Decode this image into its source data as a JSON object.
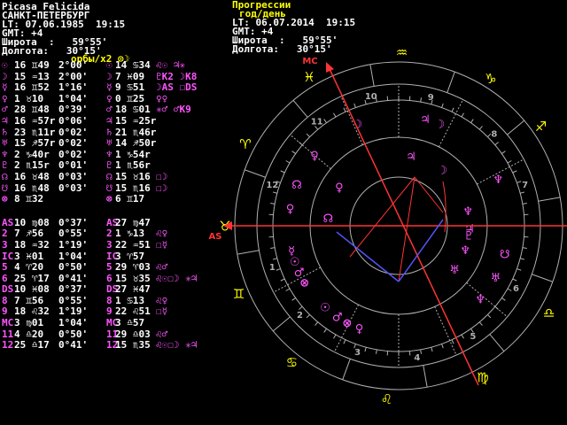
{
  "natal": {
    "name": "Picasa Felicida",
    "city": "САНКТ-ПЕТЕРБУРГ",
    "lt": "LT: 07.06.1985  19:15",
    "gmt": "GMT: +4",
    "lat": "Широта  :   59°55'",
    "lon": "Долгота:   30°15'",
    "orbs": "орбы/x2 ⊙☽"
  },
  "progressed": {
    "title": "Прогрессии",
    "subtitle": "год/день",
    "lt": "LT: 06.07.2014  19:15",
    "gmt": "GMT: +4",
    "lat": "Широта  :   59°55'",
    "lon": "Долгота:   30°15'"
  },
  "colors": {
    "yellow": "#ffff00",
    "magenta": "#ff55ff",
    "red": "#ff3333",
    "blue": "#5555ff",
    "white": "#ffffff"
  },
  "planet_rows": [
    {
      "sym": "☉",
      "pos": "16 ♊49",
      "orb": "2°00'",
      "psym": "☉",
      "ppos": "14 ♋34",
      "asp": "♌☉ ♃✳"
    },
    {
      "sym": "☽",
      "pos": "15 ♒13",
      "orb": "2°00'",
      "psym": "☽",
      "ppos": "7 ♓09",
      "asp": "♇K2 ☽K8"
    },
    {
      "sym": "☿",
      "pos": "16 ♊52",
      "orb": "1°16'",
      "psym": "☿",
      "ppos": "9 ♋51",
      "asp": "☽AS ☐DS"
    },
    {
      "sym": "♀",
      "pos": "1 ♉10",
      "orb": "1°04'",
      "psym": "♀",
      "ppos": "0 ♊25",
      "asp": "♀♀"
    },
    {
      "sym": "♂",
      "pos": "28 ♊48",
      "orb": "0°39'",
      "psym": "♂",
      "ppos": "18 ♋01",
      "asp": "✳♂ ♂K9"
    },
    {
      "sym": "♃",
      "pos": "16 ♒57r",
      "orb": "0°06'",
      "psym": "♃",
      "ppos": "15 ♒25r",
      "asp": ""
    },
    {
      "sym": "♄",
      "pos": "23 ♏11r",
      "orb": "0°02'",
      "psym": "♄",
      "ppos": "21 ♏46r",
      "asp": ""
    },
    {
      "sym": "♅",
      "pos": "15 ♐57r",
      "orb": "0°02'",
      "psym": "♅",
      "ppos": "14 ♐50r",
      "asp": ""
    },
    {
      "sym": "♆",
      "pos": "2 ♑40r",
      "orb": "0°02'",
      "psym": "♆",
      "ppos": "1 ♑54r",
      "asp": ""
    },
    {
      "sym": "♇",
      "pos": "2 ♏15r",
      "orb": "0°01'",
      "psym": "♇",
      "ppos": "1 ♏56r",
      "asp": ""
    },
    {
      "sym": "☊",
      "pos": "16 ♉48",
      "orb": "0°03'",
      "psym": "☊",
      "ppos": "15 ♉16",
      "asp": "☐☽"
    },
    {
      "sym": "☋",
      "pos": "16 ♏48",
      "orb": "0°03'",
      "psym": "☋",
      "ppos": "15 ♏16",
      "asp": "☐☽"
    },
    {
      "sym": "⊗",
      "pos": "8 ♊32",
      "orb": "",
      "psym": "⊗",
      "ppos": "6 ♊17",
      "asp": ""
    }
  ],
  "house_rows": [
    {
      "sym": "AS",
      "pos": "10 ♍08",
      "orb": "0°37'",
      "psym": "AS",
      "ppos": "27 ♍47",
      "asp": ""
    },
    {
      "sym": "2",
      "pos": "7 ♐56",
      "orb": "0°55'",
      "psym": "2",
      "ppos": "1 ♑13",
      "asp": "♌♀"
    },
    {
      "sym": "3",
      "pos": "18 ♒32",
      "orb": "1°19'",
      "psym": "3",
      "ppos": "22 ♒51",
      "asp": "☐☿"
    },
    {
      "sym": "IC",
      "pos": "3 ♓01",
      "orb": "1°04'",
      "psym": "IC",
      "ppos": "3 ♈57",
      "asp": ""
    },
    {
      "sym": "5",
      "pos": "4 ♈20",
      "orb": "0°50'",
      "psym": "5",
      "ppos": "29 ♈03",
      "asp": "♌♂"
    },
    {
      "sym": "6",
      "pos": "25 ♈17",
      "orb": "0°41'",
      "psym": "6",
      "ppos": "15 ♉35",
      "asp": "♌☉☐☽ ✳♃"
    },
    {
      "sym": "DS",
      "pos": "10 ♓08",
      "orb": "0°37'",
      "psym": "DS",
      "ppos": "27 ♓47",
      "asp": ""
    },
    {
      "sym": "8",
      "pos": "7 ♊56",
      "orb": "0°55'",
      "psym": "8",
      "ppos": "1 ♋13",
      "asp": "♌♀"
    },
    {
      "sym": "9",
      "pos": "18 ♌32",
      "orb": "1°19'",
      "psym": "9",
      "ppos": "22 ♌51",
      "asp": "☐☿"
    },
    {
      "sym": "MC",
      "pos": "3 ♍01",
      "orb": "1°04'",
      "psym": "MC",
      "ppos": "3 ♎57",
      "asp": ""
    },
    {
      "sym": "11",
      "pos": "4 ♎20",
      "orb": "0°50'",
      "psym": "11",
      "ppos": "29 ♎03",
      "asp": "♌♂"
    },
    {
      "sym": "12",
      "pos": "25 ♎17",
      "orb": "0°41'",
      "psym": "12",
      "ppos": "15 ♏35",
      "asp": "♌☉☐☽ ✳♃"
    }
  ],
  "wheel": {
    "asc_label": "AS",
    "mc_label": "MC",
    "house_numbers": [
      "1",
      "2",
      "3",
      "4",
      "5",
      "6",
      "7",
      "8",
      "9",
      "10",
      "11",
      "12"
    ],
    "outer_signs": [
      {
        "glyph": "♌",
        "deg": 266
      },
      {
        "glyph": "♋",
        "deg": 232
      },
      {
        "glyph": "♊",
        "deg": 203
      },
      {
        "glyph": "♉",
        "deg": 180
      },
      {
        "glyph": "♈",
        "deg": 152
      },
      {
        "glyph": "♓",
        "deg": 121
      },
      {
        "glyph": "♒",
        "deg": 89
      },
      {
        "glyph": "♑",
        "deg": 58
      },
      {
        "glyph": "♐",
        "deg": 35
      },
      {
        "glyph": "♏",
        "deg": 1
      },
      {
        "glyph": "♎",
        "deg": 330
      },
      {
        "glyph": "♍",
        "deg": 299
      }
    ],
    "outer_planets": [
      {
        "glyph": "♀",
        "deg": 249
      },
      {
        "glyph": "⊗",
        "deg": 242
      },
      {
        "glyph": "♂",
        "deg": 236
      },
      {
        "glyph": "☉",
        "deg": 228
      },
      {
        "glyph": "⊗",
        "deg": 211
      },
      {
        "glyph": "♂",
        "deg": 205
      },
      {
        "glyph": "☉",
        "deg": 199
      },
      {
        "glyph": "☿",
        "deg": 193
      },
      {
        "glyph": "♀",
        "deg": 171
      },
      {
        "glyph": "☊",
        "deg": 158
      },
      {
        "glyph": "♀",
        "deg": 140
      },
      {
        "glyph": "☽",
        "deg": 112
      },
      {
        "glyph": "♃",
        "deg": 76
      },
      {
        "glyph": "☽",
        "deg": 68
      },
      {
        "glyph": "♆",
        "deg": 25
      },
      {
        "glyph": "☋",
        "deg": 345
      },
      {
        "glyph": "♅",
        "deg": 332
      },
      {
        "glyph": "♆",
        "deg": 318
      }
    ],
    "inner_planets": [
      {
        "glyph": "☊",
        "deg": 174
      },
      {
        "glyph": "♀",
        "deg": 147
      },
      {
        "glyph": "♃",
        "deg": 80
      },
      {
        "glyph": "☽",
        "deg": 52
      },
      {
        "glyph": "♆",
        "deg": 340
      },
      {
        "glyph": "♅",
        "deg": 322
      },
      {
        "glyph": "♇",
        "deg": 352
      },
      {
        "glyph": "♆",
        "deg": 12
      },
      {
        "glyph": "♃",
        "deg": 358
      }
    ]
  }
}
